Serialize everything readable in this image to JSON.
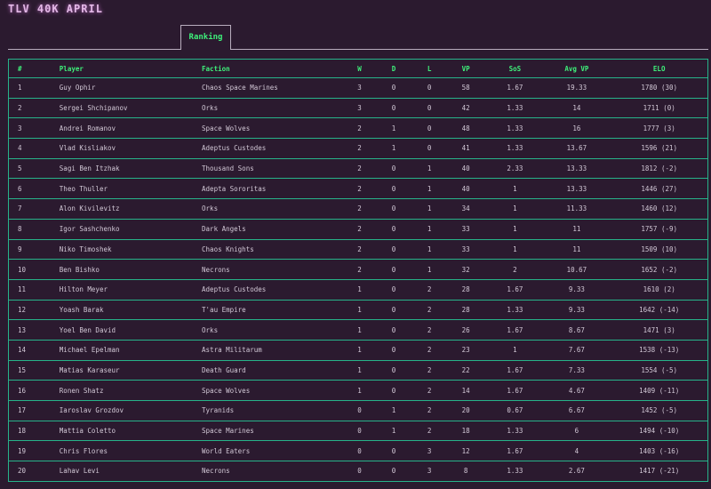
{
  "app": {
    "title": "TLV 40K APRIL"
  },
  "tabs": [
    {
      "label": "Ranking"
    }
  ],
  "table": {
    "columns": [
      "#",
      "Player",
      "Faction",
      "W",
      "D",
      "L",
      "VP",
      "SoS",
      "Avg VP",
      "ELO"
    ],
    "rows": [
      [
        "1",
        "Guy Ophir",
        "Chaos Space Marines",
        "3",
        "0",
        "0",
        "58",
        "1.67",
        "19.33",
        "1780 (30)"
      ],
      [
        "2",
        "Sergei Shchipanov",
        "Orks",
        "3",
        "0",
        "0",
        "42",
        "1.33",
        "14",
        "1711 (0)"
      ],
      [
        "3",
        "Andrei Romanov",
        "Space Wolves",
        "2",
        "1",
        "0",
        "48",
        "1.33",
        "16",
        "1777 (3)"
      ],
      [
        "4",
        "Vlad Kisliakov",
        "Adeptus Custodes",
        "2",
        "1",
        "0",
        "41",
        "1.33",
        "13.67",
        "1596 (21)"
      ],
      [
        "5",
        "Sagi Ben Itzhak",
        "Thousand Sons",
        "2",
        "0",
        "1",
        "40",
        "2.33",
        "13.33",
        "1812 (-2)"
      ],
      [
        "6",
        "Theo Thuller",
        "Adepta Sororitas",
        "2",
        "0",
        "1",
        "40",
        "1",
        "13.33",
        "1446 (27)"
      ],
      [
        "7",
        "Alon Kivilevitz",
        "Orks",
        "2",
        "0",
        "1",
        "34",
        "1",
        "11.33",
        "1460 (12)"
      ],
      [
        "8",
        "Igor Sashchenko",
        "Dark Angels",
        "2",
        "0",
        "1",
        "33",
        "1",
        "11",
        "1757 (-9)"
      ],
      [
        "9",
        "Niko Timoshek",
        "Chaos Knights",
        "2",
        "0",
        "1",
        "33",
        "1",
        "11",
        "1509 (10)"
      ],
      [
        "10",
        "Ben Bishko",
        "Necrons",
        "2",
        "0",
        "1",
        "32",
        "2",
        "10.67",
        "1652 (-2)"
      ],
      [
        "11",
        "Hilton Meyer",
        "Adeptus Custodes",
        "1",
        "0",
        "2",
        "28",
        "1.67",
        "9.33",
        "1610 (2)"
      ],
      [
        "12",
        "Yoash Barak",
        "T'au Empire",
        "1",
        "0",
        "2",
        "28",
        "1.33",
        "9.33",
        "1642 (-14)"
      ],
      [
        "13",
        "Yoel Ben David",
        "Orks",
        "1",
        "0",
        "2",
        "26",
        "1.67",
        "8.67",
        "1471 (3)"
      ],
      [
        "14",
        "Michael Epelman",
        "Astra Militarum",
        "1",
        "0",
        "2",
        "23",
        "1",
        "7.67",
        "1538 (-13)"
      ],
      [
        "15",
        "Matias Karaseur",
        "Death Guard",
        "1",
        "0",
        "2",
        "22",
        "1.67",
        "7.33",
        "1554 (-5)"
      ],
      [
        "16",
        "Ronen Shatz",
        "Space Wolves",
        "1",
        "0",
        "2",
        "14",
        "1.67",
        "4.67",
        "1409 (-11)"
      ],
      [
        "17",
        "Iaroslav Grozdov",
        "Tyranids",
        "0",
        "1",
        "2",
        "20",
        "0.67",
        "6.67",
        "1452 (-5)"
      ],
      [
        "18",
        "Mattia Coletto",
        "Space Marines",
        "0",
        "1",
        "2",
        "18",
        "1.33",
        "6",
        "1494 (-10)"
      ],
      [
        "19",
        "Chris Flores",
        "World Eaters",
        "0",
        "0",
        "3",
        "12",
        "1.67",
        "4",
        "1403 (-16)"
      ],
      [
        "20",
        "Lahav Levi",
        "Necrons",
        "0",
        "0",
        "3",
        "8",
        "1.33",
        "2.67",
        "1417 (-21)"
      ]
    ]
  },
  "colors": {
    "background": "#2b1a2f",
    "accent": "#3ef07a",
    "grid": "#27b38a",
    "title": "#e3b8e6"
  }
}
